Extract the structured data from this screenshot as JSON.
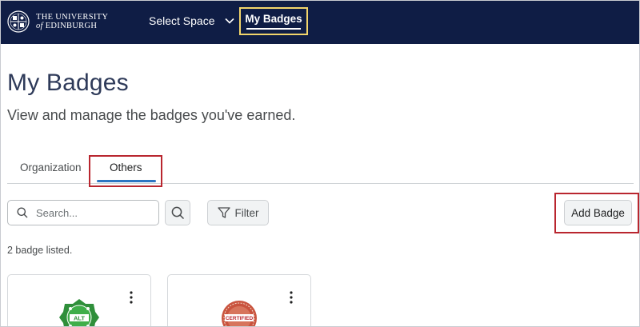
{
  "brand": {
    "line1": "THE UNIVERSITY",
    "line2_prefix": "of",
    "line2_main": "EDINBURGH"
  },
  "nav": {
    "select_space": "Select Space",
    "my_badges": "My Badges"
  },
  "page": {
    "title": "My Badges",
    "subtitle": "View and manage the badges you've earned."
  },
  "tabs": {
    "organization": "Organization",
    "others": "Others"
  },
  "toolbar": {
    "search_placeholder": "Search...",
    "filter_label": "Filter",
    "add_badge_label": "Add Badge"
  },
  "list": {
    "count_text": "2 badge listed."
  },
  "badges": [
    {
      "image_text": "ALT"
    },
    {
      "image_text": "CERTIFIED"
    }
  ],
  "colors": {
    "nav_bg": "#0f1d45",
    "nav_highlight": "#f2d56b",
    "annotation_red": "#b9262f",
    "tab_active": "#2d76c2",
    "title": "#2e3a59"
  }
}
